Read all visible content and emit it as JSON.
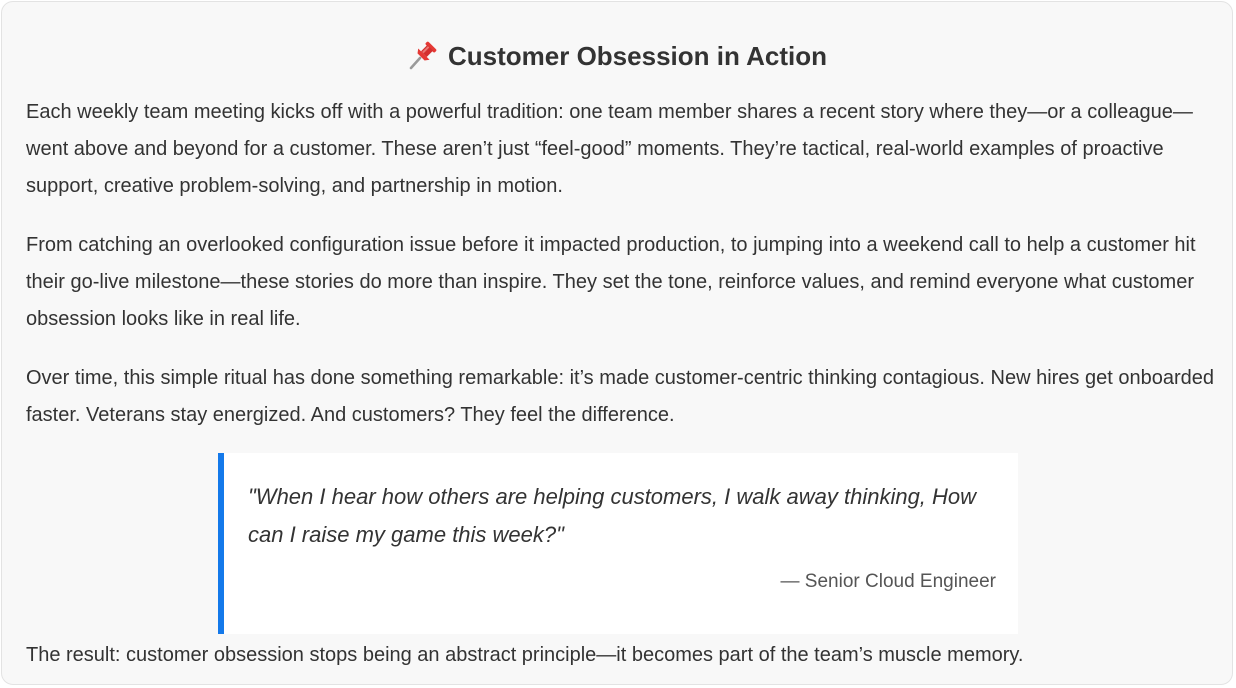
{
  "card": {
    "icon": "pushpin-icon",
    "title": "Customer Obsession in Action",
    "paragraphs": [
      "Each weekly team meeting kicks off with a powerful tradition: one team member shares a recent story where they—or a colleague—went above and beyond for a customer. These aren’t just “feel-good” moments. They’re tactical, real-world examples of proactive support, creative problem-solving, and partnership in motion.",
      "From catching an overlooked configuration issue before it impacted production, to jumping into a weekend call to help a customer hit their go-live milestone—these stories do more than inspire. They set the tone, reinforce values, and remind everyone what customer obsession looks like in real life.",
      "Over time, this simple ritual has done something remarkable: it’s made customer-centric thinking contagious. New hires get onboarded faster. Veterans stay energized. And customers? They feel the difference."
    ],
    "quote": {
      "text": "\"When I hear how others are helping customers, I walk away thinking, How can I raise my game this week?\"",
      "attribution": "— Senior Cloud Engineer"
    },
    "closing": "The result: customer obsession stops being an abstract principle—it becomes part of the team’s muscle memory."
  },
  "colors": {
    "accent": "#1479ea",
    "card_background": "#f8f8f8",
    "text": "#333333",
    "pin": "#e53935"
  }
}
